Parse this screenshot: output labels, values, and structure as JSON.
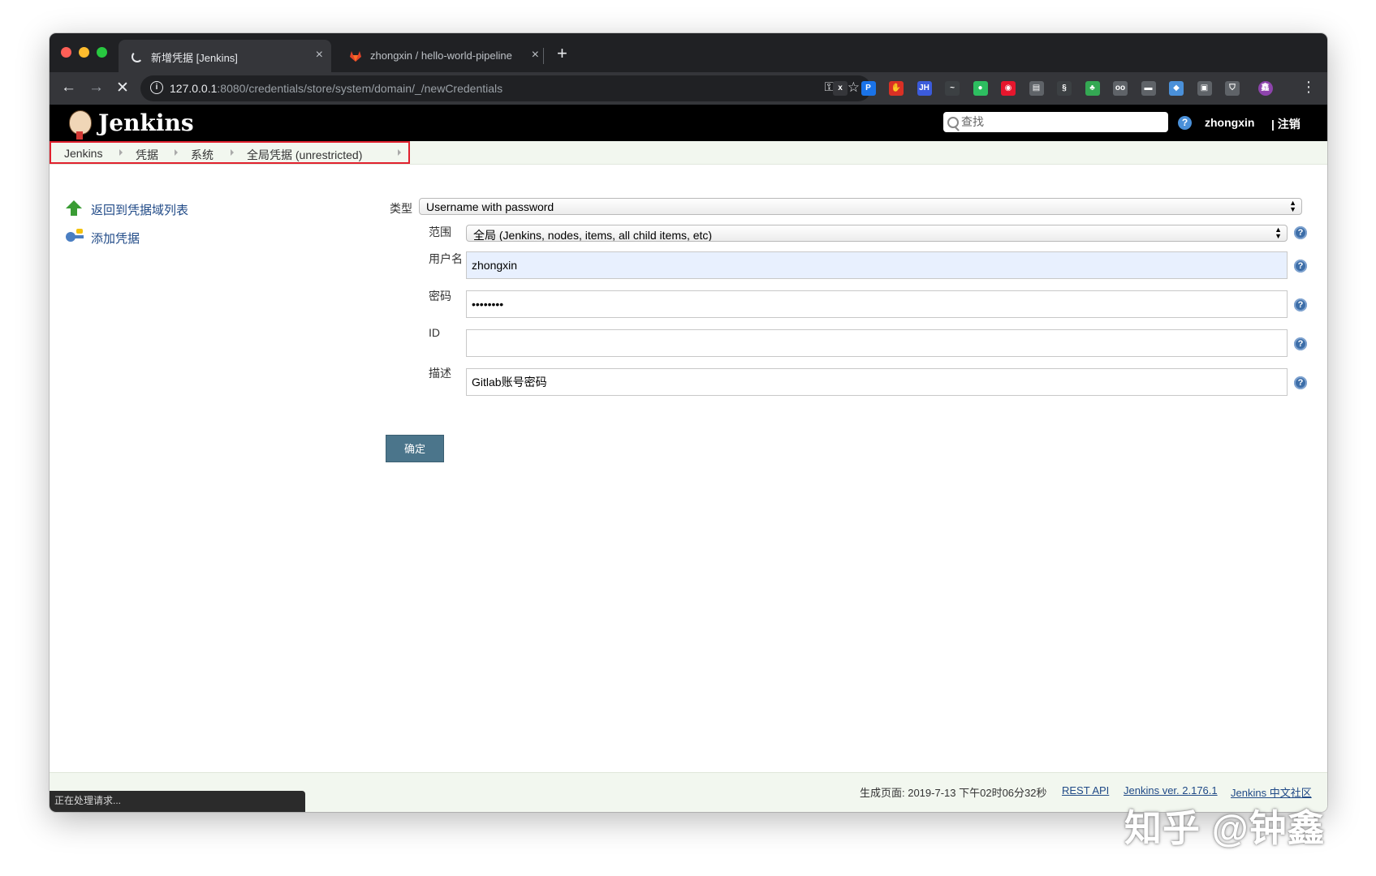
{
  "browser": {
    "tabs": [
      {
        "title": "新增凭据 [Jenkins]",
        "active": true,
        "close": "×"
      },
      {
        "title": "zhongxin / hello-world-pipeline",
        "active": false,
        "close": "×"
      }
    ],
    "new_tab": "+",
    "url_host": "127.0.0.1",
    "url_rest": ":8080/credentials/store/system/domain/_/newCredentials",
    "info_glyph": "i",
    "extensions": [
      {
        "icon": "x-icon",
        "glyph": "x",
        "color": "#35363a"
      },
      {
        "icon": "p-icon",
        "glyph": "P",
        "color": "#1a73e8"
      },
      {
        "icon": "stop-hand-icon",
        "glyph": "✋",
        "color": "#d93025"
      },
      {
        "icon": "jh-icon",
        "glyph": "JH",
        "color": "#3b5bdb"
      },
      {
        "icon": "chart-icon",
        "glyph": "~",
        "color": "#3c4043"
      },
      {
        "icon": "evernote-icon",
        "glyph": "●",
        "color": "#2dbe60"
      },
      {
        "icon": "weibo-icon",
        "glyph": "◉",
        "color": "#e6162d"
      },
      {
        "icon": "doc-icon",
        "glyph": "▤",
        "color": "#5f6368"
      },
      {
        "icon": "swirl-icon",
        "glyph": "§",
        "color": "#3c4043"
      },
      {
        "icon": "leaf-icon",
        "glyph": "♣",
        "color": "#34a853"
      },
      {
        "icon": "oo-icon",
        "glyph": "oo",
        "color": "#5f6368"
      },
      {
        "icon": "card-icon",
        "glyph": "▬",
        "color": "#5f6368"
      },
      {
        "icon": "diamond-icon",
        "glyph": "◆",
        "color": "#4a90d9"
      },
      {
        "icon": "window-icon",
        "glyph": "▣",
        "color": "#5f6368"
      },
      {
        "icon": "shield-icon",
        "glyph": "⛉",
        "color": "#5f6368"
      },
      {
        "icon": "profile-icon",
        "glyph": "鑫",
        "color": "#8e44ad"
      }
    ]
  },
  "header": {
    "brand": "Jenkins",
    "search_placeholder": "查找",
    "help_glyph": "?",
    "user": "zhongxin",
    "logout": "| 注销"
  },
  "breadcrumb": [
    "Jenkins",
    "凭据",
    "系统",
    "全局凭据 (unrestricted)"
  ],
  "side_panel": {
    "back_link": "返回到凭据域列表",
    "add_link": "添加凭据"
  },
  "form": {
    "kind_label": "类型",
    "kind_value": "Username with password",
    "scope_label": "范围",
    "scope_value": "全局 (Jenkins, nodes, items, all child items, etc)",
    "username_label": "用户名",
    "username_value": "zhongxin",
    "password_label": "密码",
    "password_value": "••••••••",
    "id_label": "ID",
    "id_value": "",
    "description_label": "描述",
    "description_value": "Gitlab账号密码",
    "submit": "确定",
    "select_arrows": "▲▼"
  },
  "footer": {
    "generated": "生成页面: 2019-7-13 下午02时06分32秒",
    "rest_api": "REST API",
    "version": "Jenkins ver. 2.176.1",
    "community": "Jenkins 中文社区"
  },
  "status_bar": "正在处理请求...",
  "watermark": "知乎 @钟鑫"
}
